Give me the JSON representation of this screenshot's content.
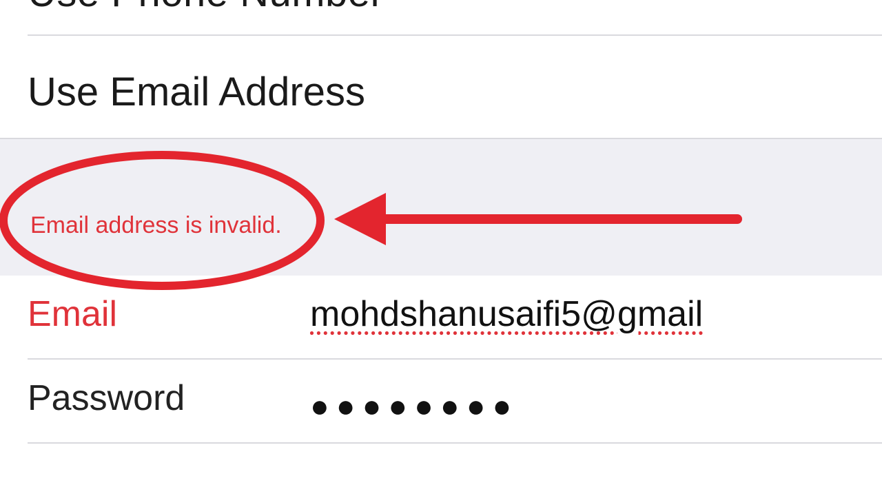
{
  "options": {
    "use_phone_label": "Use Phone Number",
    "use_email_label": "Use Email Address"
  },
  "error": {
    "message": "Email address is invalid."
  },
  "form": {
    "email_label": "Email",
    "email_value": "mohdshanusaifi5@gmail",
    "password_label": "Password",
    "password_masked": "●●●●●●●●"
  },
  "annotation": {
    "ellipse_color": "#e3252e",
    "arrow_color": "#e3252e"
  }
}
